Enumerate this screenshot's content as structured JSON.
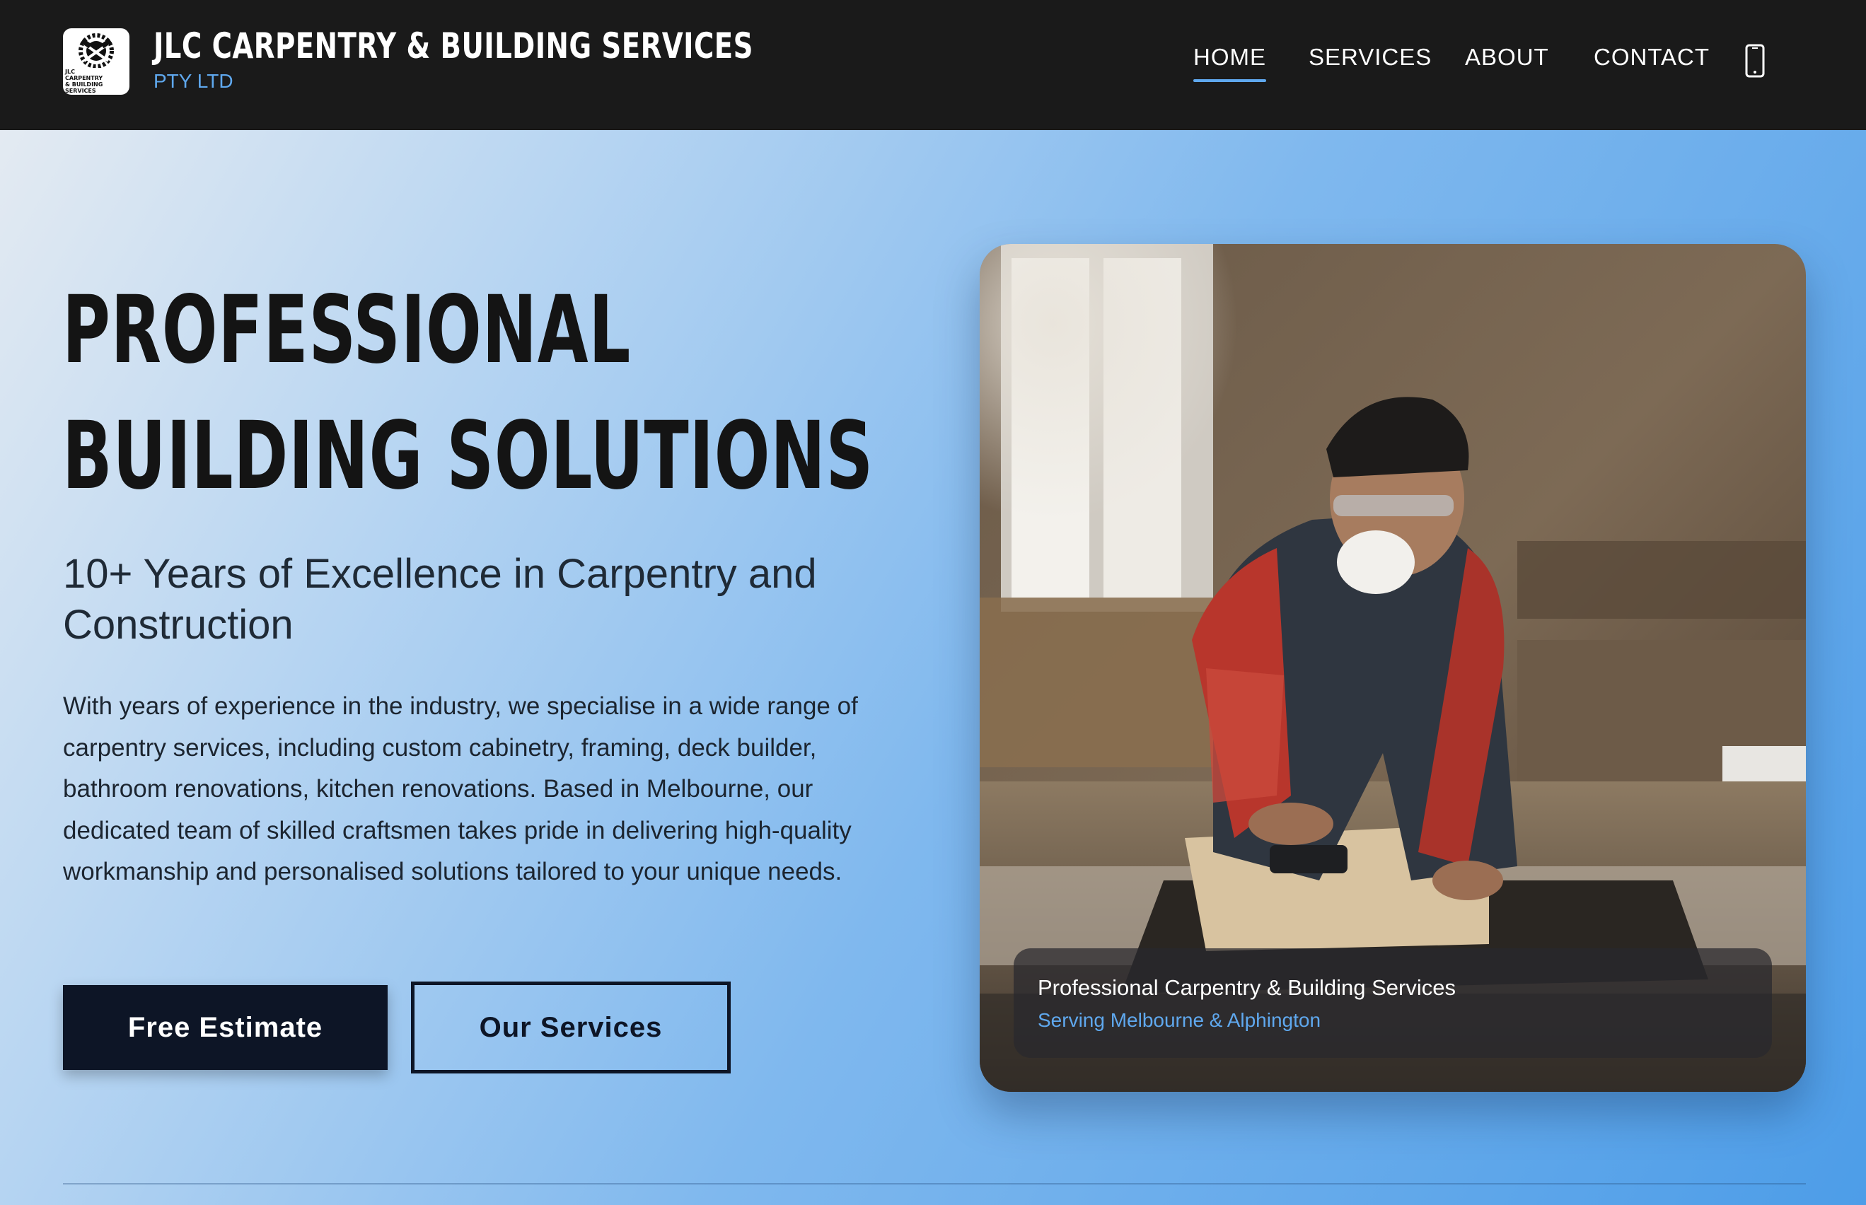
{
  "brand": {
    "title": "JLC CARPENTRY & BUILDING SERVICES",
    "subtitle": "PTY LTD",
    "logo_text": "JLC CARPENTRY & BUILDING SERVICES PTY LTD",
    "logo_icon": "saw-hammer-logo"
  },
  "nav": {
    "items": [
      {
        "label": "HOME",
        "active": true
      },
      {
        "label": "SERVICES",
        "active": false
      },
      {
        "label": "ABOUT",
        "active": false
      },
      {
        "label": "CONTACT",
        "active": false
      }
    ],
    "phone_icon": "phone-icon"
  },
  "hero": {
    "title_line1": "PROFESSIONAL",
    "title_line2": "BUILDING SOLUTIONS",
    "subtitle": "10+ Years of Excellence in Carpentry and Construction",
    "body": "With years of experience in the industry, we specialise in a wide range of carpentry services, including custom cabinetry, framing, deck builder, bathroom renovations, kitchen renovations. Based in Melbourne, our dedicated team of skilled craftsmen takes pride in delivering high-quality workmanship and personalised solutions tailored to your unique needs.",
    "primary_button": "Free Estimate",
    "secondary_button": "Our Services"
  },
  "photo": {
    "caption_title": "Professional Carpentry & Building Services",
    "caption_subtitle": "Serving Melbourne & Alphington"
  },
  "colors": {
    "header_bg": "#1a1a1a",
    "accent": "#5fa8ee",
    "button_dark": "#0d1526",
    "text_dark": "#141414"
  }
}
